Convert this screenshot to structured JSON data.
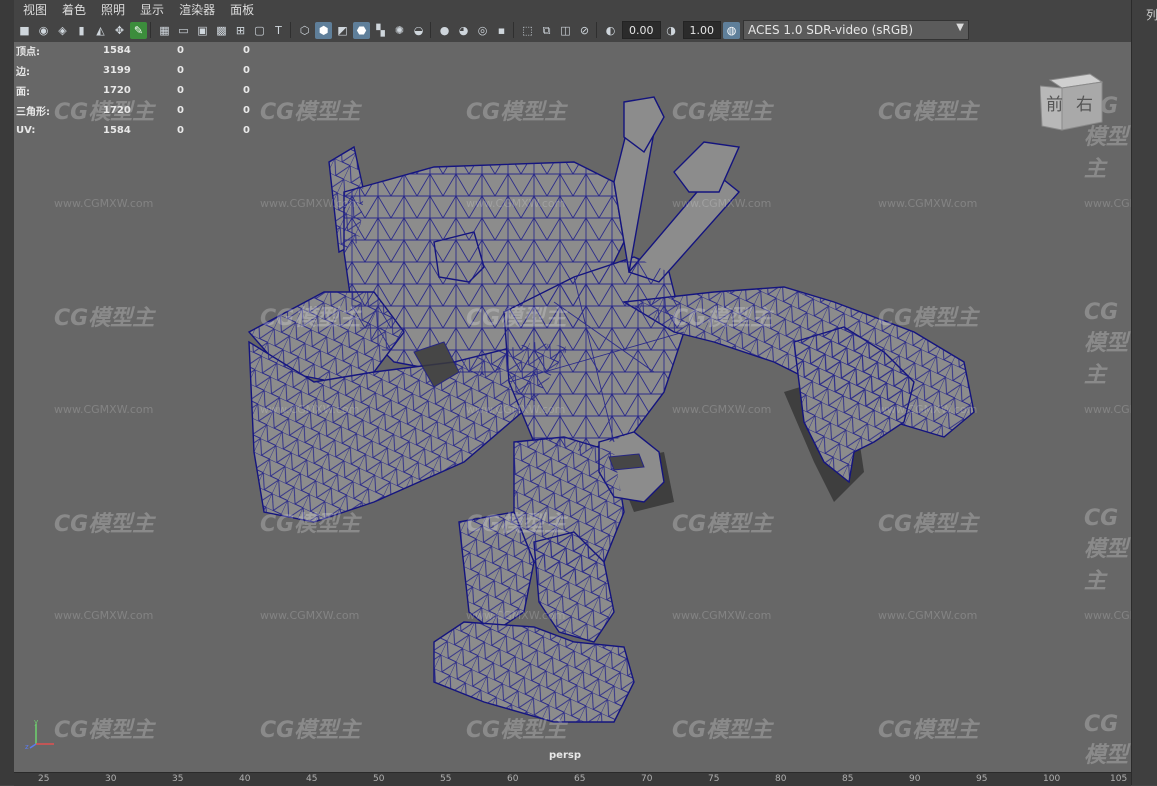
{
  "menu": [
    "视图",
    "着色",
    "照明",
    "显示",
    "渲染器",
    "面板"
  ],
  "toolbar": {
    "exposure_value": "0.00",
    "gamma_value": "1.00",
    "color_space": "ACES 1.0 SDR-video (sRGB)"
  },
  "hud": {
    "rows": [
      {
        "label": "顶点:",
        "v1": "1584",
        "v2": "0",
        "v3": "0"
      },
      {
        "label": "边:",
        "v1": "3199",
        "v2": "0",
        "v3": "0"
      },
      {
        "label": "面:",
        "v1": "1720",
        "v2": "0",
        "v3": "0"
      },
      {
        "label": "三角形:",
        "v1": "1720",
        "v2": "0",
        "v3": "0"
      },
      {
        "label": "UV:",
        "v1": "1584",
        "v2": "0",
        "v3": "0"
      }
    ]
  },
  "viewcube": {
    "front": "前",
    "right": "右"
  },
  "camera_label": "persp",
  "right_panel_header": "列",
  "ruler_ticks": [
    "25",
    "30",
    "35",
    "40",
    "45",
    "50",
    "55",
    "60",
    "65",
    "70",
    "75",
    "80",
    "85",
    "90",
    "95",
    "100",
    "105"
  ],
  "watermark": {
    "logo": "CG模型主",
    "url": "www.CGMXW.com"
  },
  "colors": {
    "viewport": "#676767",
    "wireframe": "#1a1a8c",
    "mesh_fill": "#8c8c8c",
    "ui_bg": "#444444",
    "active_tool": "#5f7f9a"
  }
}
